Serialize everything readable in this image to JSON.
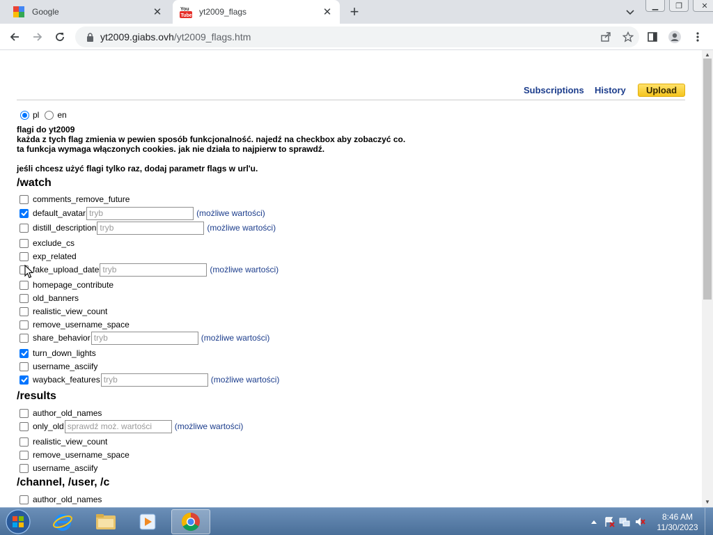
{
  "tabs": [
    {
      "title": "Google",
      "icon": "google-favicon"
    },
    {
      "title": "yt2009_flags",
      "icon": "youtube-favicon"
    }
  ],
  "address": {
    "domain": "yt2009.giabs.ovh",
    "path": "/yt2009_flags.htm"
  },
  "topnav": {
    "subscriptions": "Subscriptions",
    "history": "History",
    "upload": "Upload"
  },
  "lang": {
    "pl": "pl",
    "en": "en",
    "selected": "pl"
  },
  "intro": [
    "flagi do yt2009",
    "każda z tych flag zmienia w pewien sposób funkcjonalność. najedź na checkbox aby zobaczyć co.",
    "ta funkcja wymaga włączonych cookies. jak nie działa to najpierw to sprawdź.",
    "",
    "jeśli chcesz użyć flagi tylko raz, dodaj parametr flags w url'u."
  ],
  "sections": [
    {
      "title": "/watch",
      "flags": [
        {
          "name": "comments_remove_future",
          "checked": false
        },
        {
          "name": "default_avatar",
          "checked": true,
          "placeholder": "tryb",
          "link": "(możliwe wartości)"
        },
        {
          "name": "distill_description",
          "checked": false,
          "placeholder": "tryb",
          "link": "(możliwe wartości)"
        },
        {
          "name": "exclude_cs",
          "checked": false
        },
        {
          "name": "exp_related",
          "checked": false
        },
        {
          "name": "fake_upload_date",
          "checked": false,
          "placeholder": "tryb",
          "link": "(możliwe wartości)"
        },
        {
          "name": "homepage_contribute",
          "checked": false
        },
        {
          "name": "old_banners",
          "checked": false
        },
        {
          "name": "realistic_view_count",
          "checked": false
        },
        {
          "name": "remove_username_space",
          "checked": false
        },
        {
          "name": "share_behavior",
          "checked": false,
          "placeholder": "tryb",
          "link": "(możliwe wartości)"
        },
        {
          "name": "turn_down_lights",
          "checked": true
        },
        {
          "name": "username_asciify",
          "checked": false
        },
        {
          "name": "wayback_features",
          "checked": true,
          "placeholder": "tryb",
          "link": "(możliwe wartości)"
        }
      ]
    },
    {
      "title": "/results",
      "flags": [
        {
          "name": "author_old_names",
          "checked": false
        },
        {
          "name": "only_old",
          "checked": false,
          "placeholder": "sprawdź moż. wartości",
          "link": "(możliwe wartości)"
        },
        {
          "name": "realistic_view_count",
          "checked": false
        },
        {
          "name": "remove_username_space",
          "checked": false
        },
        {
          "name": "username_asciify",
          "checked": false
        }
      ]
    },
    {
      "title": "/channel, /user, /c",
      "flags": [
        {
          "name": "author_old_names",
          "checked": false
        }
      ]
    }
  ],
  "clock": {
    "time": "8:46 AM",
    "date": "11/30/2023"
  },
  "colors": {
    "accent": "#0075ff",
    "link": "#1c3d8c",
    "upload": "#f5c51f"
  }
}
